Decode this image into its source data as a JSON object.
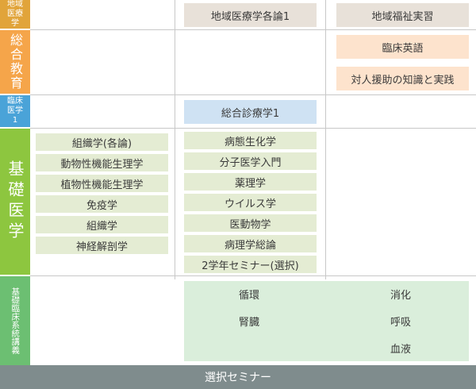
{
  "colors": {
    "community": "#e1a43a",
    "general": "#f5a54a",
    "clinical": "#4aa3d8",
    "basic": "#8dc63f",
    "systems": "#6cbf72",
    "footer": "#7f8c8d"
  },
  "sidebar": {
    "community_medicine": "地域医療学",
    "general_education": "総合教育",
    "clinical_medicine": "臨床医学1",
    "basic_medicine": "基礎医学",
    "systems_lectures": "基礎臨床系統講義"
  },
  "community_row": {
    "col2": "地域医療学各論1",
    "col3": "地域福祉実習"
  },
  "general_row": {
    "items": [
      "臨床英語",
      "対人援助の知識と実践"
    ]
  },
  "clinical_row": {
    "col2": "総合診療学1"
  },
  "basic_row": {
    "col1": [
      "組織学(各論)",
      "動物性機能生理学",
      "植物性機能生理学",
      "免疫学",
      "組織学",
      "神経解剖学"
    ],
    "col2": [
      "病態生化学",
      "分子医学入門",
      "薬理学",
      "ウイルス学",
      "医動物学",
      "病理学総論",
      "2学年セミナー(選択)"
    ]
  },
  "systems_row": {
    "left": [
      "循環",
      "腎臓"
    ],
    "right": [
      "消化",
      "呼吸",
      "血液"
    ]
  },
  "footer": {
    "label": "選択セミナー"
  }
}
